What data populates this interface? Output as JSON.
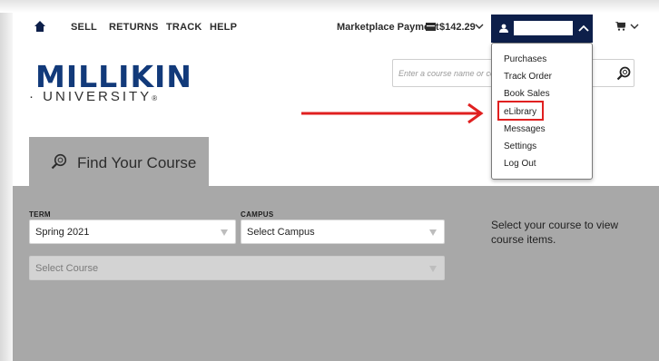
{
  "nav": {
    "links": [
      "SELL",
      "RETURNS",
      "TRACK",
      "HELP"
    ],
    "marketplace_label": "Marketplace Payment",
    "marketplace_amount": "$142.29"
  },
  "logo": {
    "name": "MILLIKIN",
    "sub": "UNIVERSITY"
  },
  "search": {
    "placeholder": "Enter a course name or code"
  },
  "account_menu": {
    "items": [
      "Purchases",
      "Track Order",
      "Book Sales",
      "eLibrary",
      "Messages",
      "Settings",
      "Log Out"
    ],
    "highlighted": "eLibrary"
  },
  "tab": {
    "label": "Find Your Course"
  },
  "form": {
    "term_label": "TERM",
    "term_value": "Spring 2021",
    "campus_label": "CAMPUS",
    "campus_value": "Select Campus",
    "course_value": "Select Course",
    "hint": "Select your course to view course items."
  },
  "colors": {
    "navy": "#0d1f4a",
    "logo_blue": "#123a7a",
    "panel_gray": "#a8a8a8",
    "annotation_red": "#e02020"
  },
  "icons": [
    "home-icon",
    "wallet-icon",
    "user-icon",
    "chevron-up-icon",
    "cart-icon",
    "search-icon",
    "find-icon"
  ]
}
